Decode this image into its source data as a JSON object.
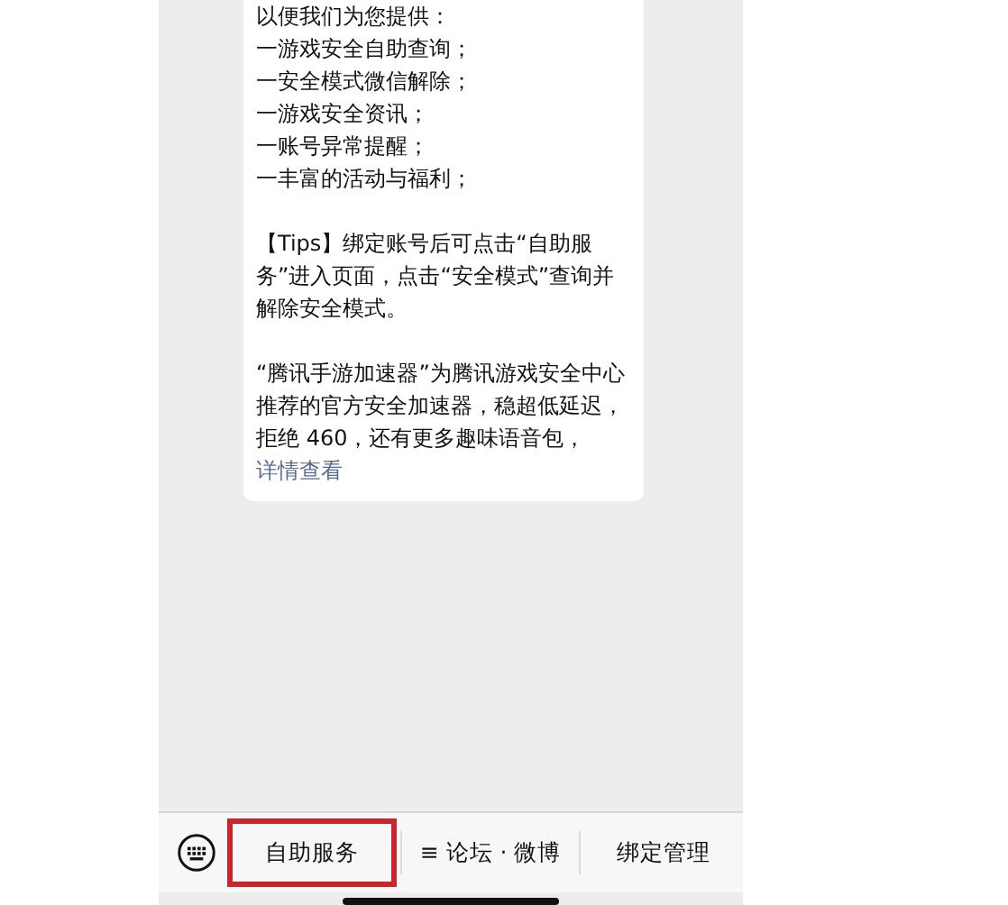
{
  "message": {
    "lines": [
      "以便我们为您提供：",
      "一游戏安全自助查询；",
      "一安全模式微信解除；",
      "一游戏安全资讯；",
      "一账号异常提醒；",
      "一丰富的活动与福利；"
    ],
    "tips": "【Tips】绑定账号后可点击“自助服务”进入页面，点击“安全模式”查询并解除安全模式。",
    "promo": "“腾讯手游加速器”为腾讯游戏安全中心推荐的官方安全加速器，稳超低延迟，拒绝 460，还有更多趣味语音包，",
    "link": "详情查看"
  },
  "menu": [
    {
      "label": "自助服务",
      "highlighted": true
    },
    {
      "label": "≡ 论坛 · 微博",
      "highlighted": false
    },
    {
      "label": "绑定管理",
      "highlighted": false
    }
  ]
}
